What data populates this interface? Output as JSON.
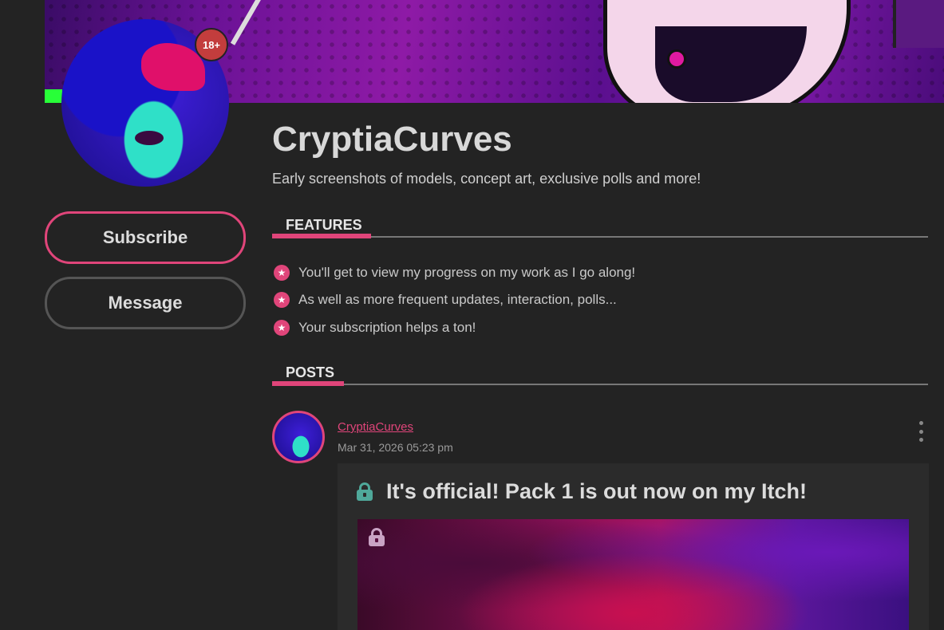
{
  "creator": {
    "name": "CryptiaCurves",
    "tagline": "Early screenshots of models, concept art, exclusive polls and more!",
    "age_badge": "18+"
  },
  "actions": {
    "subscribe_label": "Subscribe",
    "message_label": "Message"
  },
  "features": {
    "heading": "FEATURES",
    "items": [
      "You'll get to view my progress on my work as I go along!",
      "As well as more frequent updates, interaction, polls...",
      "Your subscription helps a ton!"
    ]
  },
  "posts": {
    "heading": "POSTS",
    "items": [
      {
        "author": "CryptiaCurves",
        "date": "Mar 31, 2026 05:23 pm",
        "title": "It's official! Pack 1 is out now on my Itch!"
      }
    ]
  },
  "colors": {
    "accent": "#e0457a",
    "background": "#232323",
    "lock_teal": "#4fa89a"
  },
  "icons": [
    "star-icon",
    "lock-icon",
    "kebab-icon"
  ]
}
